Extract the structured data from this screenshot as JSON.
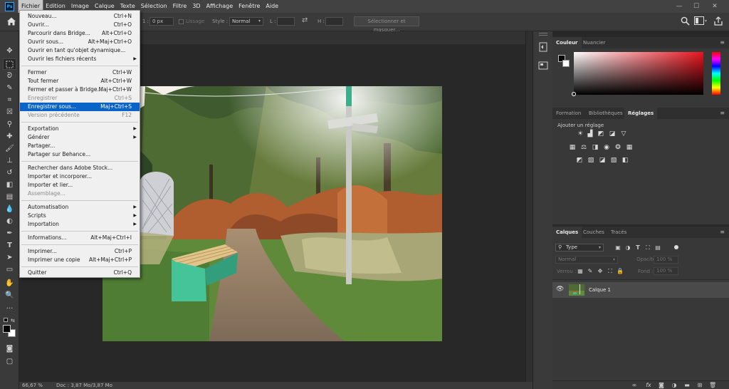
{
  "app": {
    "logo": "Ps"
  },
  "menubar": {
    "items": [
      "Fichier",
      "Edition",
      "Image",
      "Calque",
      "Texte",
      "Sélection",
      "Filtre",
      "3D",
      "Affichage",
      "Fenêtre",
      "Aide"
    ],
    "active": "Fichier"
  },
  "window": {
    "minimize": "—",
    "maximize": "☐",
    "close": "✕"
  },
  "options": {
    "feather_value": "0 px",
    "feather_suffix": "1 :",
    "smooth_label": "Lissage",
    "style_label": "Style :",
    "style_value": "Normal",
    "width_label": "L :",
    "height_label": "H :",
    "swap_icon": "swap-icon",
    "select_mask_label": "Sélectionner et masquer..."
  },
  "file_menu": {
    "items": [
      {
        "label": "Nouveau...",
        "shortcut": "Ctrl+N",
        "state": "normal"
      },
      {
        "label": "Ouvrir...",
        "shortcut": "Ctrl+O",
        "state": "normal"
      },
      {
        "label": "Parcourir dans Bridge...",
        "shortcut": "Alt+Ctrl+O",
        "state": "normal"
      },
      {
        "label": "Ouvrir sous...",
        "shortcut": "Alt+Maj+Ctrl+O",
        "state": "normal"
      },
      {
        "label": "Ouvrir en tant qu'objet dynamique...",
        "shortcut": "",
        "state": "normal"
      },
      {
        "label": "Ouvrir les fichiers récents",
        "shortcut": "",
        "state": "submenu"
      },
      {
        "label": "Fermer",
        "shortcut": "Ctrl+W",
        "state": "normal"
      },
      {
        "label": "Tout fermer",
        "shortcut": "Alt+Ctrl+W",
        "state": "normal"
      },
      {
        "label": "Fermer et passer à Bridge...",
        "shortcut": "Maj+Ctrl+W",
        "state": "normal"
      },
      {
        "label": "Enregistrer",
        "shortcut": "Ctrl+S",
        "state": "disabled"
      },
      {
        "label": "Enregistrer sous...",
        "shortcut": "Maj+Ctrl+S",
        "state": "highlighted"
      },
      {
        "label": "Version précédente",
        "shortcut": "F12",
        "state": "disabled"
      },
      {
        "label": "Exportation",
        "shortcut": "",
        "state": "submenu"
      },
      {
        "label": "Générer",
        "shortcut": "",
        "state": "submenu"
      },
      {
        "label": "Partager...",
        "shortcut": "",
        "state": "normal"
      },
      {
        "label": "Partager sur Behance...",
        "shortcut": "",
        "state": "normal"
      },
      {
        "label": "Rechercher dans Adobe Stock...",
        "shortcut": "",
        "state": "normal"
      },
      {
        "label": "Importer et incorporer...",
        "shortcut": "",
        "state": "normal"
      },
      {
        "label": "Importer et lier...",
        "shortcut": "",
        "state": "normal"
      },
      {
        "label": "Assemblage...",
        "shortcut": "",
        "state": "disabled"
      },
      {
        "label": "Automatisation",
        "shortcut": "",
        "state": "submenu"
      },
      {
        "label": "Scripts",
        "shortcut": "",
        "state": "submenu"
      },
      {
        "label": "Importation",
        "shortcut": "",
        "state": "submenu"
      },
      {
        "label": "Informations...",
        "shortcut": "Alt+Maj+Ctrl+I",
        "state": "normal"
      },
      {
        "label": "Imprimer...",
        "shortcut": "Ctrl+P",
        "state": "normal"
      },
      {
        "label": "Imprimer une copie",
        "shortcut": "Alt+Maj+Ctrl+P",
        "state": "normal"
      },
      {
        "label": "Quitter",
        "shortcut": "Ctrl+Q",
        "state": "normal"
      }
    ]
  },
  "color_panel": {
    "tabs": [
      "Couleur",
      "Nuancier"
    ],
    "active_tab": "Couleur",
    "hue_color": "#e8141e"
  },
  "adjust_panel": {
    "tabs": [
      "Formation",
      "Bibliothèques",
      "Réglages"
    ],
    "active_tab": "Réglages",
    "heading": "Ajouter un réglage"
  },
  "layers_panel": {
    "tabs": [
      "Calques",
      "Couches",
      "Tracés"
    ],
    "active_tab": "Calques",
    "filter_value": "Type",
    "blend_mode": "Normal",
    "opacity_label": "Opacité :",
    "opacity_value": "100 %",
    "lock_label": "Verrou :",
    "fill_label": "Fond :",
    "fill_value": "100 %",
    "layers": [
      {
        "name": "Calque 1",
        "visible": true
      }
    ]
  },
  "status": {
    "zoom": "66,67 %",
    "doc": "Doc : 3,87 Mo/3,87 Mo"
  }
}
